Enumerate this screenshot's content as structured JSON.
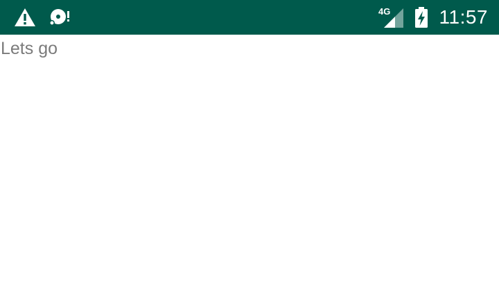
{
  "status_bar": {
    "background": "#005a4c",
    "time": "11:57",
    "network_type": "4G",
    "left_icons": [
      "warning-icon",
      "disc-alert-icon"
    ],
    "right_icons": [
      "signal-icon",
      "battery-charging-icon"
    ]
  },
  "main": {
    "text": "Lets go",
    "text_color": "#7b7b7b",
    "background": "#ffffff"
  }
}
